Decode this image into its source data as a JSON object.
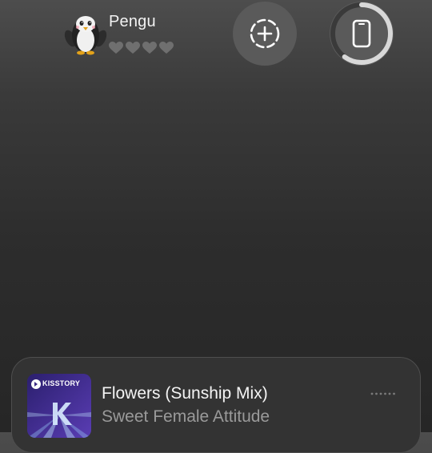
{
  "pet": {
    "name": "Pengu",
    "hearts_filled": 0,
    "hearts_total": 4
  },
  "buttons": {
    "add_icon": "dashed-circle-plus-icon",
    "device_icon": "phone-icon",
    "device_progress": 0.6
  },
  "now_playing": {
    "art_label": "KISSTORY",
    "title": "Flowers (Sunship Mix)",
    "artist": "Sweet Female Attitude",
    "more_icon": "more-dots-icon"
  },
  "colors": {
    "background_top": "#4d4d4d",
    "background_bottom": "#262626",
    "button_fill": "#5a5a5a",
    "card_fill": "#333333",
    "artwork_purple": "#3b2a84"
  }
}
